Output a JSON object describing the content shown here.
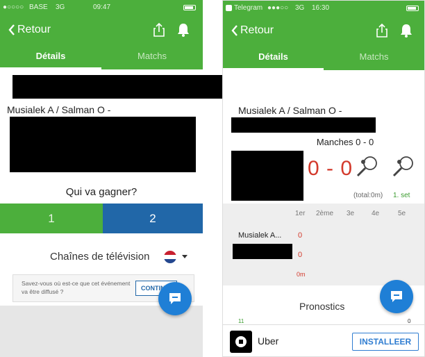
{
  "left_screen": {
    "status": {
      "carrier": "BASE",
      "network": "3G",
      "time": "09:47"
    },
    "nav": {
      "back_label": "Retour"
    },
    "tabs": [
      {
        "label": "Détails"
      },
      {
        "label": "Matchs"
      }
    ],
    "match_title": "Musialek A / Salman O -",
    "vote": {
      "question": "Qui va gagner?",
      "option_1": "1",
      "option_2": "2"
    },
    "tv": {
      "label": "Chaînes de télévision"
    },
    "info": {
      "text": "Savez-vous où est-ce que cet événement va être diffusé ?",
      "button_label": "CONTINUER"
    }
  },
  "right_screen": {
    "status": {
      "carrier": "Telegram",
      "network": "3G",
      "time": "16:30"
    },
    "nav": {
      "back_label": "Retour"
    },
    "tabs": [
      {
        "label": "Détails"
      },
      {
        "label": "Matchs"
      }
    ],
    "match_title": "Musialek A / Salman O -",
    "manches": "Manches 0 - 0",
    "score": "0 - 0",
    "total": "(total:0m)",
    "current_set": "1. set",
    "set_headers": [
      "1er",
      "2ème",
      "3e",
      "4e",
      "5e"
    ],
    "player_name": "Musialek A...",
    "player_score_1": "0",
    "player_score_2": "0",
    "duration": "0m",
    "pronostics": "Pronostics",
    "prono_left": "11",
    "prono_right": "0",
    "ad": {
      "brand": "Uber",
      "button_label": "INSTALLEER"
    }
  },
  "colors": {
    "accent_green": "#4caf3c",
    "accent_blue": "#2167a8",
    "score_red": "#d33a2c",
    "fab_blue": "#1f7fd6"
  },
  "icons": [
    "back-chevron-icon",
    "share-icon",
    "bell-icon",
    "chat-icon",
    "racket-icon",
    "dutch-flag-icon",
    "uber-logo-icon"
  ]
}
